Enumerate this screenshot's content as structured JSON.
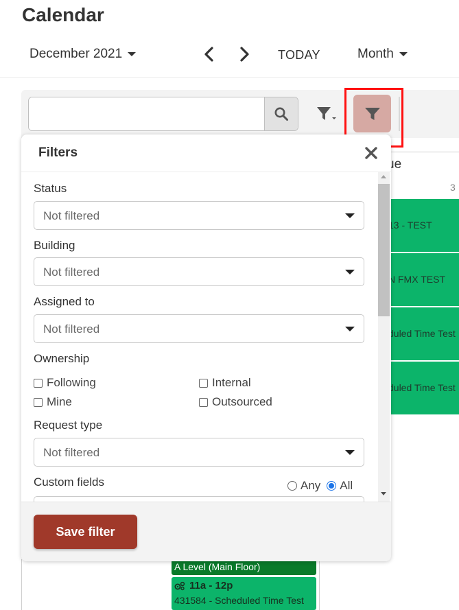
{
  "page": {
    "title": "Calendar"
  },
  "nav": {
    "month": "December 2021",
    "prev_icon": "chevron-left-icon",
    "next_icon": "chevron-right-icon",
    "today_label": "TODAY",
    "view": "Month"
  },
  "toolbar": {
    "search_value": "",
    "search_icon": "search-icon",
    "filter_menu_icon": "filter-dropdown-icon",
    "filter_icon": "filter-icon",
    "filter_active_color": "#d6a9a3",
    "highlight_color": "#ff1010"
  },
  "calendar": {
    "column_header": "ue",
    "day_number": "3",
    "event_color": "#0cb46a",
    "events_right": [
      {
        "text": "13 - TEST"
      },
      {
        "text": "N FMX TEST"
      },
      {
        "text": "duled Time Test"
      },
      {
        "text": "duled Time Test"
      }
    ],
    "location_text": "A Level (Main Floor)",
    "event_time": "11a - 12p",
    "event_title": "431584 - Scheduled Time Test"
  },
  "filters": {
    "title": "Filters",
    "close_icon": "close-icon",
    "status": {
      "label": "Status",
      "value": "Not filtered"
    },
    "building": {
      "label": "Building",
      "value": "Not filtered"
    },
    "assigned_to": {
      "label": "Assigned to",
      "value": "Not filtered"
    },
    "ownership": {
      "label": "Ownership",
      "options": [
        {
          "label": "Following",
          "checked": false
        },
        {
          "label": "Internal",
          "checked": false
        },
        {
          "label": "Mine",
          "checked": false
        },
        {
          "label": "Outsourced",
          "checked": false
        }
      ]
    },
    "request_type": {
      "label": "Request type",
      "value": "Not filtered"
    },
    "custom_fields": {
      "label": "Custom fields",
      "match_any": "Any",
      "match_all": "All",
      "selected": "All"
    },
    "save_label": "Save filter",
    "save_color": "#a0392a"
  }
}
